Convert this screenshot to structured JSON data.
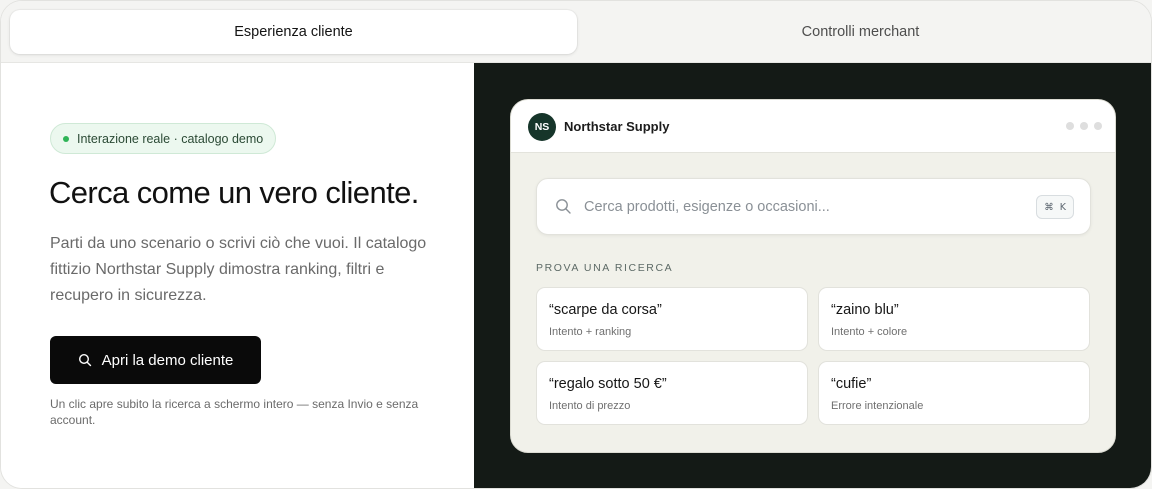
{
  "tabs": [
    {
      "label": "Esperienza cliente",
      "active": true
    },
    {
      "label": "Controlli merchant",
      "active": false
    }
  ],
  "hero": {
    "badge": "Interazione reale · catalogo demo",
    "headline": "Cerca come un vero cliente.",
    "description": "Parti da uno scenario o scrivi ciò che vuoi. Il catalogo fittizio Northstar Supply dimostra ranking, filtri e recupero in sicurezza.",
    "cta_label": "Apri la demo cliente",
    "note": "Un clic apre subito la ricerca a schermo intero — senza Invio e senza account."
  },
  "demo": {
    "avatar_initials": "NS",
    "brand": "Northstar Supply",
    "search_placeholder": "Cerca prodotti, esigenze o occasioni...",
    "shortcut_mod": "⌘",
    "shortcut_key": "K",
    "section_label": "PROVA UNA RICERCA",
    "suggestions": [
      {
        "query": "“scarpe da corsa”",
        "hint": "Intento + ranking"
      },
      {
        "query": "“zaino blu”",
        "hint": "Intento + colore"
      },
      {
        "query": "“regalo sotto 50 €”",
        "hint": "Intento di prezzo"
      },
      {
        "query": "“cufie”",
        "hint": "Errore intenzionale"
      }
    ]
  },
  "colors": {
    "accent_dark": "#0a0a0a",
    "right_panel_bg": "#141a16",
    "badge_bg": "#ecf8ef",
    "badge_dot": "#2fb457",
    "avatar_bg": "#16352a"
  },
  "icons": {
    "cta": "search-icon",
    "search": "search-icon",
    "window_controls": "dots-icon"
  }
}
